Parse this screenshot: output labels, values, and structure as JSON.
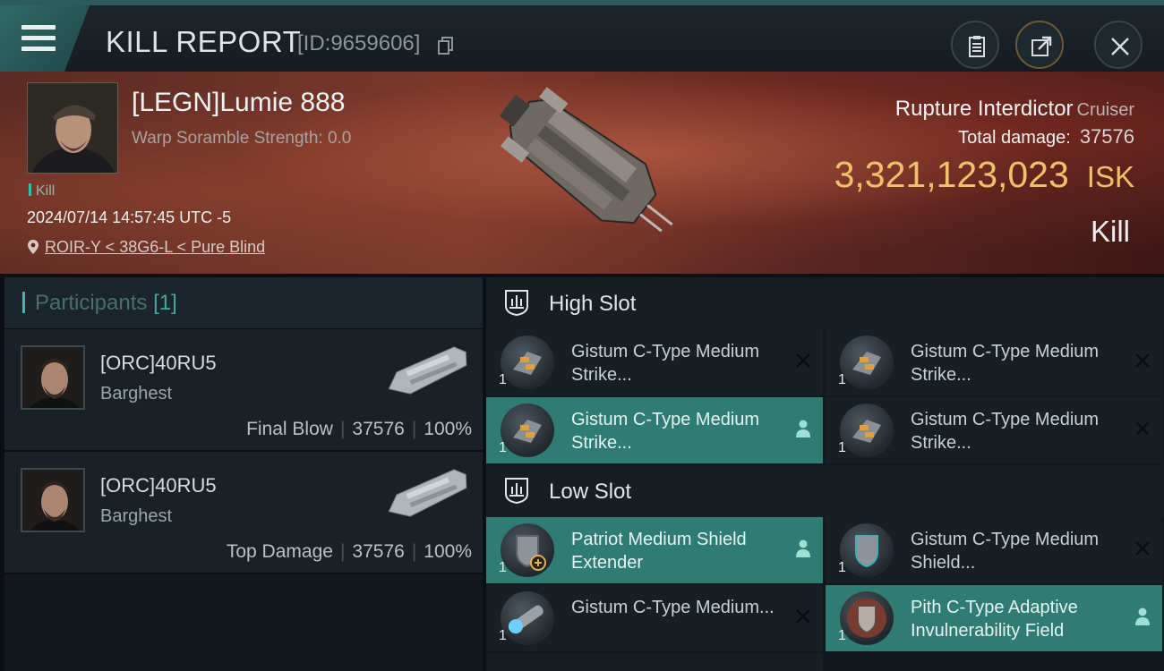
{
  "header": {
    "title": "KILL REPORT",
    "report_id": "[ID:9659606]",
    "buttons": [
      "clipboard",
      "export",
      "close"
    ]
  },
  "victim": {
    "name": "[LEGN]Lumie 888",
    "scramble": "Warp Soramble Strength: 0.0",
    "kill_tag": "Kill",
    "timestamp": "2024/07/14 14:57:45 UTC -5",
    "location": "ROIR-Y < 38G6-L < Pure Blind",
    "ship_name": "Rupture Interdictor",
    "ship_class": "Cruiser",
    "damage_label": "Total damage:",
    "damage_value": "37576",
    "isk_value": "3,321,123,023",
    "isk_unit": "ISK",
    "result": "Kill"
  },
  "participants": {
    "title": "Participants",
    "count": "[1]",
    "rows": [
      {
        "name": "[ORC]40RU5",
        "ship": "Barghest",
        "role": "Final Blow",
        "damage": "37576",
        "percent": "100%"
      },
      {
        "name": "[ORC]40RU5",
        "ship": "Barghest",
        "role": "Top Damage",
        "damage": "37576",
        "percent": "100%"
      }
    ]
  },
  "slots": {
    "high": {
      "label": "High Slot",
      "modules": [
        {
          "name": "Gistum C-Type Medium Strike...",
          "qty": "1",
          "state": "destroyed",
          "icon": "missile-launcher"
        },
        {
          "name": "Gistum C-Type Medium Strike...",
          "qty": "1",
          "state": "destroyed",
          "icon": "missile-launcher"
        },
        {
          "name": "Gistum C-Type Medium Strike...",
          "qty": "1",
          "state": "dropped",
          "icon": "missile-launcher"
        },
        {
          "name": "Gistum C-Type Medium Strike...",
          "qty": "1",
          "state": "destroyed",
          "icon": "missile-launcher"
        }
      ]
    },
    "low": {
      "label": "Low Slot",
      "modules": [
        {
          "name": "Patriot Medium Shield Extender",
          "qty": "1",
          "state": "dropped",
          "icon": "shield-extender"
        },
        {
          "name": "Gistum C-Type Medium Shield...",
          "qty": "1",
          "state": "destroyed",
          "icon": "shield-extender"
        },
        {
          "name": "Gistum C-Type Medium...",
          "qty": "1",
          "state": "destroyed",
          "icon": "shield-booster"
        },
        {
          "name": "Pith C-Type Adaptive Invulnerability Field",
          "qty": "1",
          "state": "dropped",
          "icon": "invulnerability-field"
        }
      ]
    }
  },
  "colors": {
    "accent": "#3db8b0",
    "isk": "#f0c06a",
    "dropped_row": "#2e7c74"
  }
}
